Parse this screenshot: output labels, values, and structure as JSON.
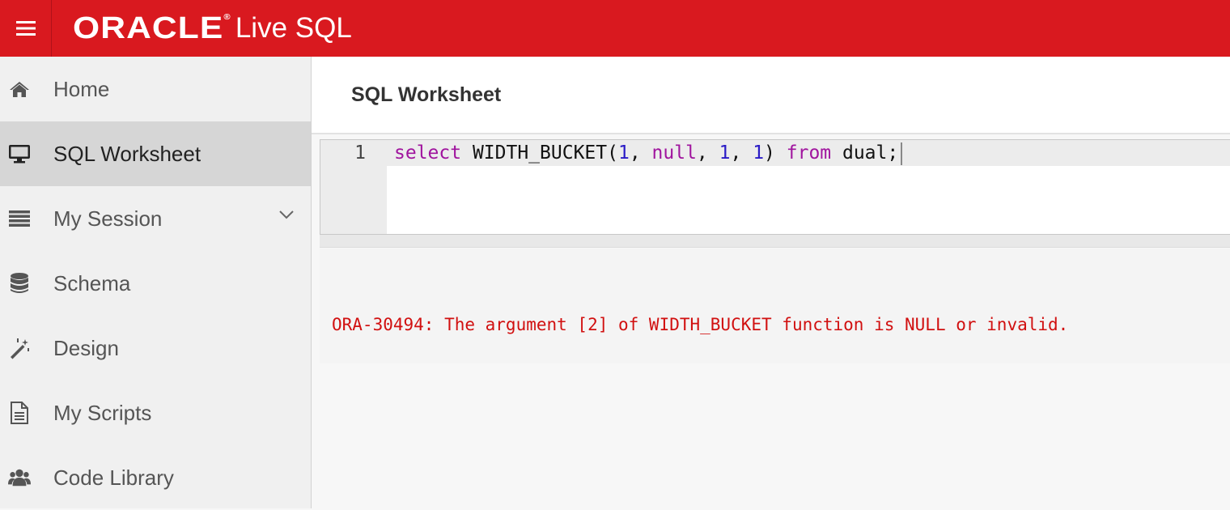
{
  "header": {
    "menu_icon": "hamburger-menu-icon",
    "logo_text": "ORACLE",
    "logo_reg": "®",
    "app_name": "Live SQL",
    "brand_color": "#d9191f"
  },
  "sidebar": {
    "items": [
      {
        "label": "Home",
        "icon": "home-icon",
        "active": false
      },
      {
        "label": "SQL Worksheet",
        "icon": "desktop-icon",
        "active": true
      },
      {
        "label": "My Session",
        "icon": "list-icon",
        "active": false,
        "expandable": true
      },
      {
        "label": "Schema",
        "icon": "database-icon",
        "active": false
      },
      {
        "label": "Design",
        "icon": "magic-wand-icon",
        "active": false
      },
      {
        "label": "My Scripts",
        "icon": "document-icon",
        "active": false
      },
      {
        "label": "Code Library",
        "icon": "users-icon",
        "active": false
      }
    ]
  },
  "worksheet": {
    "title": "SQL Worksheet",
    "line_number": "1",
    "code": {
      "t1": "select",
      "t2": " WIDTH_BUCKET(",
      "t3": "1",
      "t4": ", ",
      "t5": "null",
      "t6": ", ",
      "t7": "1",
      "t8": ", ",
      "t9": "1",
      "t10": ") ",
      "t11": "from",
      "t12": " dual;"
    }
  },
  "results": {
    "error": "ORA-30494: The argument [2] of WIDTH_BUCKET function is NULL or invalid.",
    "error_color": "#d11010"
  }
}
